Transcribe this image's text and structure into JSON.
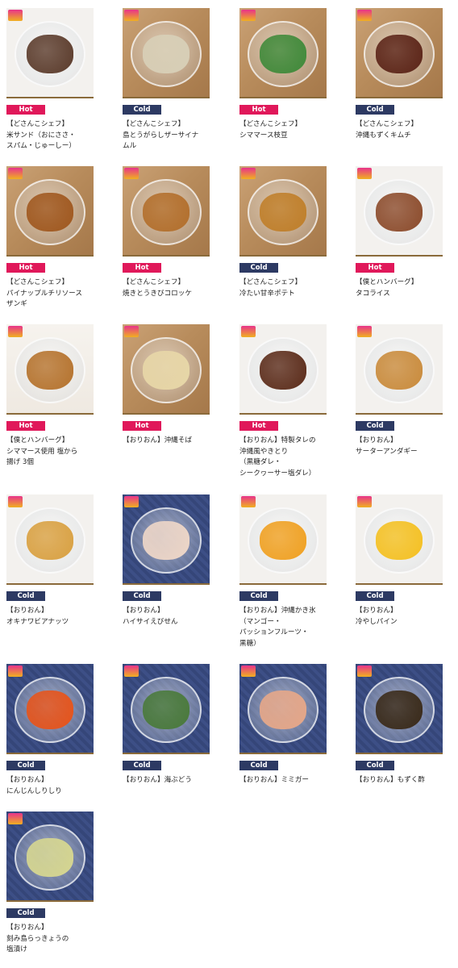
{
  "colors": {
    "hot": "#e0185a",
    "cold": "#2d3a63"
  },
  "items": [
    {
      "badge": "Hot",
      "name": "【どさんこシェフ】\n米サンド（おにささ・\nスパム・じゅーしー）",
      "bg": "white",
      "food": "#5a3a2a",
      "icon": "rice-sandwich-photo"
    },
    {
      "badge": "Cold",
      "name": "【どさんこシェフ】\n島とうがらしザーサイナ\nムル",
      "bg": "wood",
      "food": "#d8d0b8",
      "icon": "zasai-namul-photo"
    },
    {
      "badge": "Hot",
      "name": "【どさんこシェフ】\nシママース枝豆",
      "bg": "wood",
      "food": "#3f8a3a",
      "icon": "edamame-photo"
    },
    {
      "badge": "Cold",
      "name": "【どさんこシェフ】\n沖縄もずくキムチ",
      "bg": "wood",
      "food": "#5b2418",
      "icon": "mozuku-kimchi-photo"
    },
    {
      "badge": "Hot",
      "name": "【どさんこシェフ】\nパイナップルチリソース\nザンギ",
      "bg": "wood",
      "food": "#a0581f",
      "icon": "zangi-photo"
    },
    {
      "badge": "Hot",
      "name": "【どさんこシェフ】\n焼きとうきびコロッケ",
      "bg": "wood",
      "food": "#b36f2c",
      "icon": "croquette-photo"
    },
    {
      "badge": "Cold",
      "name": "【どさんこシェフ】\n冷たい甘辛ポテト",
      "bg": "wood",
      "food": "#c07f2a",
      "icon": "potato-photo"
    },
    {
      "badge": "Hot",
      "name": "【僕とハンバーグ】\nタコライス",
      "bg": "white",
      "food": "#8b4a2a",
      "icon": "taco-rice-photo"
    },
    {
      "badge": "Hot",
      "name": "【僕とハンバーグ】\nシママース使用 塩から\n揚げ 3個",
      "bg": "red",
      "food": "#b5722c",
      "icon": "karaage-photo"
    },
    {
      "badge": "Hot",
      "name": "【おりおん】沖縄そば",
      "bg": "wood",
      "food": "#e8d8a8",
      "icon": "okinawa-soba-photo"
    },
    {
      "badge": "Hot",
      "name": "【おりおん】特製タレの\n沖縄風やきとり\n（黒糖ダレ・\nシークヮーサー塩ダレ）",
      "bg": "white",
      "food": "#5a2a18",
      "icon": "yakitori-photo"
    },
    {
      "badge": "Cold",
      "name": "【おりおん】\nサーターアンダギー",
      "bg": "white",
      "food": "#c98a3a",
      "icon": "andagi-photo"
    },
    {
      "badge": "Cold",
      "name": "【おりおん】\nオキナワビアナッツ",
      "bg": "white",
      "food": "#d9a040",
      "icon": "beer-nuts-photo"
    },
    {
      "badge": "Cold",
      "name": "【おりおん】\nハイサイえびせん",
      "bg": "blue",
      "food": "#f0d8c8",
      "icon": "ebisen-photo"
    },
    {
      "badge": "Cold",
      "name": "【おりおん】沖縄かき氷\n（マンゴー・\nパッションフルーツ・\n黒糖）",
      "bg": "white",
      "food": "#f0a020",
      "icon": "kakigori-photo"
    },
    {
      "badge": "Cold",
      "name": "【おりおん】\n冷やしパイン",
      "bg": "white",
      "food": "#f4c020",
      "icon": "pineapple-photo"
    },
    {
      "badge": "Cold",
      "name": "【おりおん】\nにんじんしりしり",
      "bg": "blue",
      "food": "#e8541a",
      "icon": "carrot-shirishiri-photo"
    },
    {
      "badge": "Cold",
      "name": "【おりおん】海ぶどう",
      "bg": "blue",
      "food": "#4a7a3a",
      "icon": "umibudo-photo"
    },
    {
      "badge": "Cold",
      "name": "【おりおん】ミミガー",
      "bg": "blue",
      "food": "#e8a888",
      "icon": "mimiga-photo"
    },
    {
      "badge": "Cold",
      "name": "【おりおん】もずく酢",
      "bg": "blue",
      "food": "#3a2a18",
      "icon": "mozuku-su-photo"
    },
    {
      "badge": "Cold",
      "name": "【おりおん】\n刻み島らっきょうの\n塩漬け",
      "bg": "blue",
      "food": "#d8d890",
      "icon": "rakkyo-photo"
    }
  ]
}
